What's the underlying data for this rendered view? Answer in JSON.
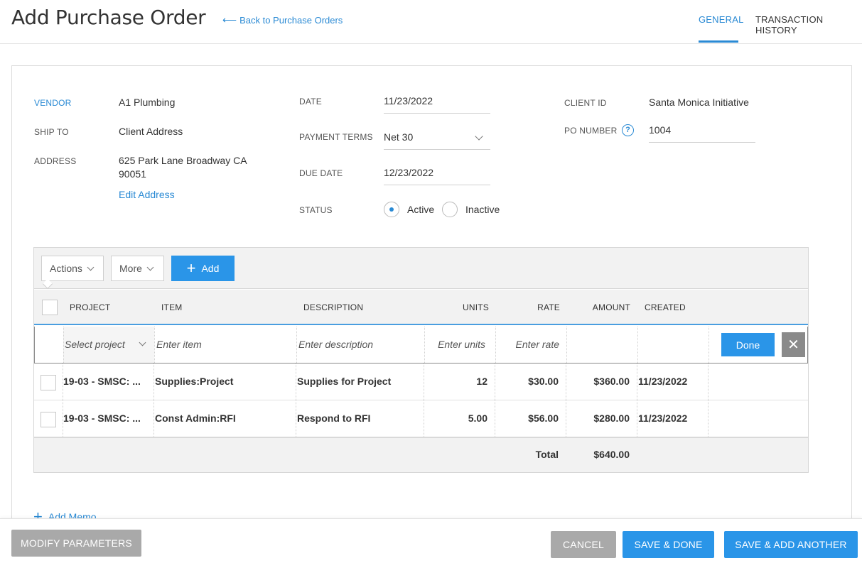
{
  "header": {
    "title": "Add Purchase Order",
    "back_link": "Back to Purchase Orders",
    "tabs": [
      {
        "label": "GENERAL",
        "active": true
      },
      {
        "label": "TRANSACTION HISTORY",
        "active": false
      }
    ]
  },
  "form": {
    "vendor_label": "VENDOR",
    "vendor_value": "A1 Plumbing",
    "ship_to_label": "SHIP TO",
    "ship_to_value": "Client Address",
    "address_label": "ADDRESS",
    "address_line1": "625 Park Lane Broadway CA",
    "address_line2": "90051",
    "edit_address": "Edit Address",
    "date_label": "DATE",
    "date_value": "11/23/2022",
    "payment_terms_label": "PAYMENT TERMS",
    "payment_terms_value": "Net 30",
    "due_date_label": "DUE DATE",
    "due_date_value": "12/23/2022",
    "status_label": "STATUS",
    "status_active": "Active",
    "status_inactive": "Inactive",
    "client_id_label": "CLIENT ID",
    "client_id_value": "Santa Monica Initiative",
    "po_number_label": "PO NUMBER",
    "po_number_value": "1004",
    "help_glyph": "?"
  },
  "grid": {
    "toolbar": {
      "actions_label": "Actions",
      "more_label": "More",
      "add_label": "Add"
    },
    "columns": [
      "PROJECT",
      "ITEM",
      "DESCRIPTION",
      "UNITS",
      "RATE",
      "AMOUNT",
      "CREATED"
    ],
    "entry": {
      "project_placeholder": "Select project",
      "item_placeholder": "Enter item",
      "description_placeholder": "Enter description",
      "units_placeholder": "Enter units",
      "rate_placeholder": "Enter rate",
      "done_label": "Done",
      "cancel_glyph": "✕"
    },
    "rows": [
      {
        "project": "19-03 - SMSC: ...",
        "item": "Supplies:Project",
        "description": "Supplies for Project",
        "units": "12",
        "rate": "$30.00",
        "amount": "$360.00",
        "created": "11/23/2022"
      },
      {
        "project": "19-03 - SMSC: ...",
        "item": "Const Admin:RFI",
        "description": "Respond to RFI",
        "units": "5.00",
        "rate": "$56.00",
        "amount": "$280.00",
        "created": "11/23/2022"
      }
    ],
    "total_label": "Total",
    "total_value": "$640.00"
  },
  "memo_label": "Add Memo",
  "footer": {
    "modify_parameters": "MODIFY PARAMETERS",
    "cancel": "CANCEL",
    "save_done": "SAVE & DONE",
    "save_add_another": "SAVE & ADD ANOTHER"
  },
  "colors": {
    "accent": "#2a8ad4",
    "button_blue": "#2a95e8",
    "button_gray": "#a9a9a9"
  }
}
